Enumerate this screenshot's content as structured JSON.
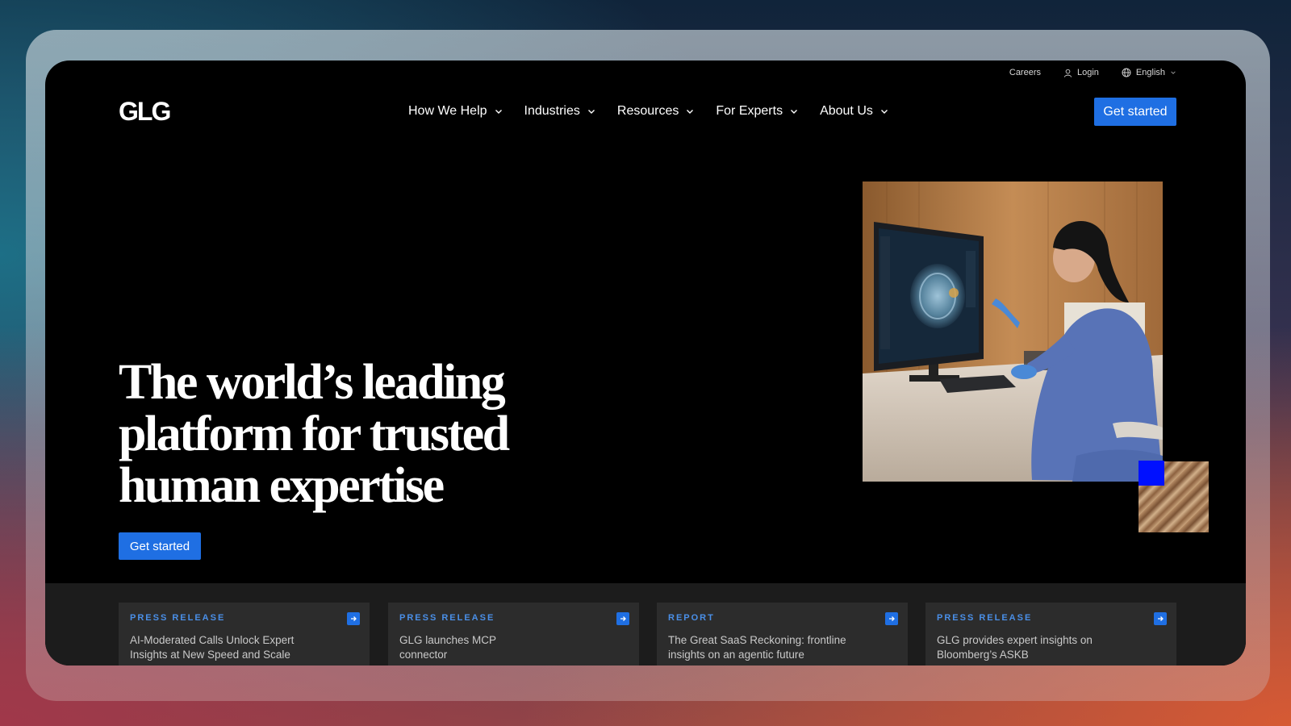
{
  "utility_bar": {
    "careers": "Careers",
    "login": "Login",
    "language": "English"
  },
  "header": {
    "logo": "GLG",
    "nav": [
      {
        "label": "How We Help"
      },
      {
        "label": "Industries"
      },
      {
        "label": "Resources"
      },
      {
        "label": "For Experts"
      },
      {
        "label": "About Us"
      }
    ],
    "cta": "Get started"
  },
  "hero": {
    "title_lines": [
      "The world’s leading",
      "platform for trusted",
      "human expertise"
    ],
    "cta": "Get started",
    "image": "clinician-reviewing-brain-scan"
  },
  "news": [
    {
      "tag": "PRESS RELEASE",
      "text": "AI-Moderated Calls Unlock Expert Insights at New Speed and Scale"
    },
    {
      "tag": "PRESS RELEASE",
      "text": "GLG launches MCP connector"
    },
    {
      "tag": "REPORT",
      "text": "The Great SaaS Reckoning: frontline insights on an agentic future"
    },
    {
      "tag": "PRESS RELEASE",
      "text": "GLG provides expert insights on Bloomberg’s ASKB"
    }
  ],
  "colors": {
    "accent": "#1f6fe3",
    "tag": "#4a8fe8",
    "deco_square": "#0010ff"
  }
}
